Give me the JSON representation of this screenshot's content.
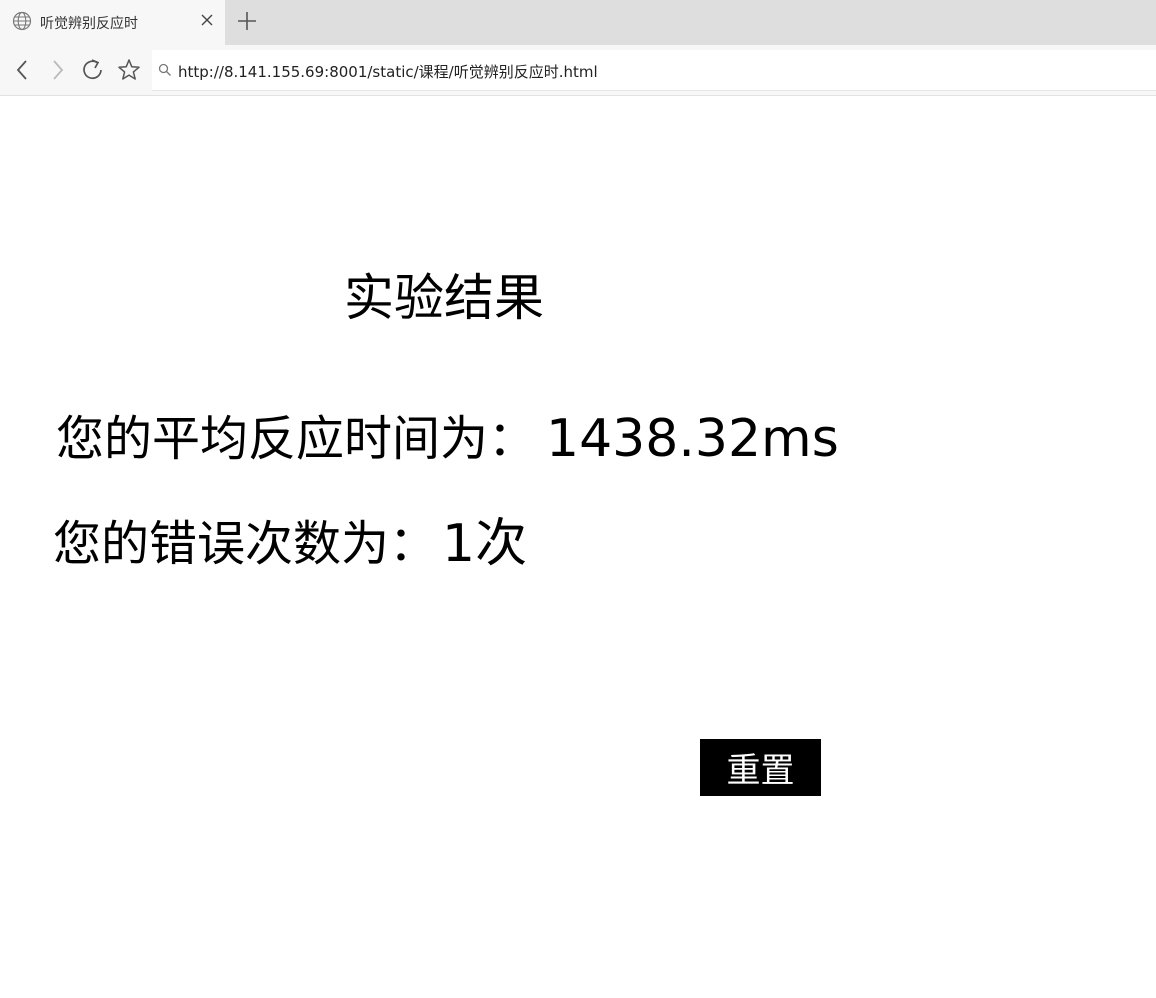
{
  "browser": {
    "tab": {
      "title": "听觉辨别反应时",
      "icon": "globe-icon"
    },
    "address": "http://8.141.155.69:8001/static/课程/听觉辨别反应时.html",
    "icons": [
      "back-icon",
      "forward-icon",
      "reload-icon",
      "star-icon",
      "search-icon",
      "close-icon",
      "plus-icon"
    ]
  },
  "page": {
    "title": "实验结果",
    "reaction_time_label": "您的平均反应时间为：",
    "reaction_time_value": "1438.32ms",
    "error_count_label": "您的错误次数为：",
    "error_count_value": "1次",
    "reset_label": "重置"
  },
  "colors": {
    "button_bg": "#000000",
    "button_text": "#ffffff",
    "tabbar_bg": "#dedede",
    "active_tab_bg": "#f7f7f7"
  }
}
